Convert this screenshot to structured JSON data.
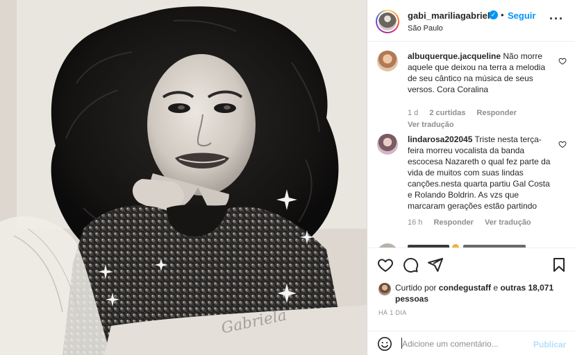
{
  "post": {
    "username": "gabi_mariliagabriela",
    "follow_label": "Seguir",
    "separator": "•",
    "location": "São Paulo",
    "more_label": "···"
  },
  "photo": {
    "description_icon": "portrait-photo",
    "signature_text": "Gabriela"
  },
  "comments": [
    {
      "username": "albuquerque.jacqueline",
      "text": "Não morre aquele que deixou na terra a melodia de seu cântico na música de seus versos. Cora Coralina",
      "time": "1 d",
      "likes": "2 curtidas",
      "reply": "Responder",
      "translate": "Ver tradução"
    },
    {
      "username": "lindarosa202045",
      "text": "Triste nesta terça-feira morreu vocalista da banda escocesa Nazareth o qual fez parte da vida de muitos com suas lindas canções.nesta quarta partiu Gal Costa e Rolando Boldrin. As vzs que marcaram gerações estão partindo",
      "time": "16 h",
      "reply": "Responder",
      "translate": "Ver tradução"
    }
  ],
  "likes": {
    "prefix": "Curtido por",
    "liker": "condegustaff",
    "connector": "e",
    "others": "outras 18,071 pessoas"
  },
  "time_ago": "HÁ 1 DIA",
  "composer": {
    "placeholder": "Adicione um comentário...",
    "publish_label": "Publicar"
  },
  "colors": {
    "accent": "#0095f6",
    "publish_disabled": "#b2dffc",
    "muted": "#8e8e8e",
    "text": "#262626"
  }
}
